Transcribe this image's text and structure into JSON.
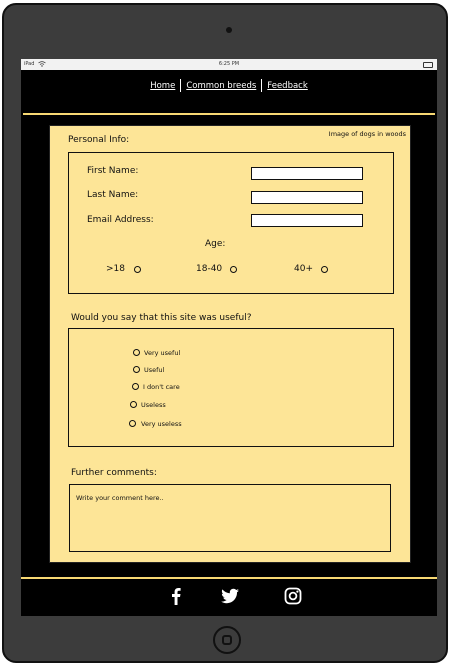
{
  "statusbar": {
    "device": "iPad",
    "time": "6:25 PM"
  },
  "nav": {
    "links": [
      "Home",
      "Common breeds",
      "Feedback"
    ]
  },
  "form": {
    "image_label": "Image of dogs in woods",
    "personal": {
      "title": "Personal Info:",
      "first_name": "First Name:",
      "last_name": "Last Name:",
      "email": "Email Address:",
      "age_label": "Age:",
      "age_options": [
        ">18",
        "18-40",
        "40+"
      ]
    },
    "useful": {
      "question": "Would you say that this site was useful?",
      "options": [
        "Very useful",
        "Useful",
        "I don't care",
        "Useless",
        "Very useless"
      ]
    },
    "comments": {
      "title": "Further comments:",
      "placeholder": "Write your comment here.."
    }
  },
  "footer": {
    "icons": [
      "facebook-icon",
      "twitter-icon",
      "instagram-icon"
    ]
  },
  "colors": {
    "accent": "#f7d873",
    "form_bg": "#fde597",
    "nav_bg": "#000000"
  }
}
